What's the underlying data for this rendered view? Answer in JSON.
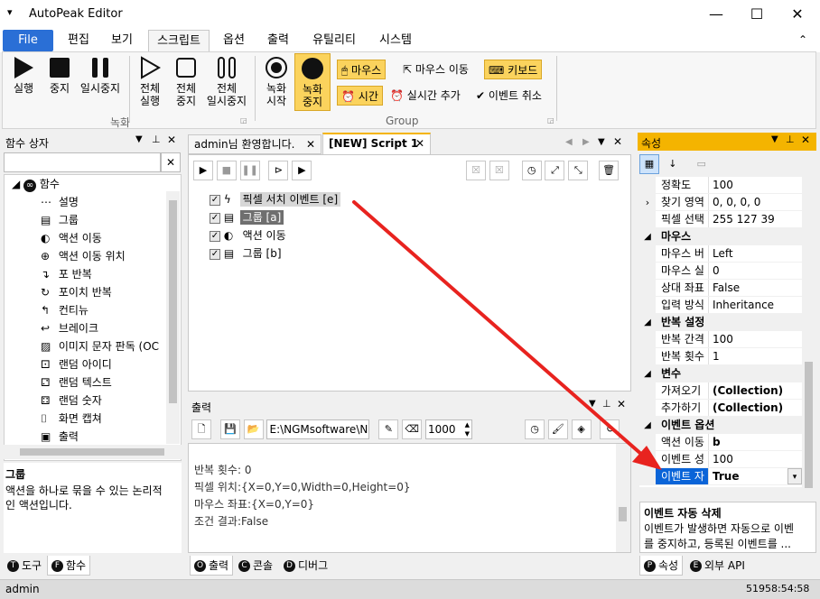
{
  "window": {
    "title": "AutoPeak Editor",
    "min": "—",
    "max": "☐",
    "close": "✕"
  },
  "menu": {
    "file": "File",
    "items": [
      "편집",
      "보기",
      "스크립트",
      "옵션",
      "출력",
      "유틸리티",
      "시스템"
    ]
  },
  "ribbon": {
    "run": "실행",
    "stop": "중지",
    "pause": "일시중지",
    "run_all": [
      "전체",
      "실행"
    ],
    "stop_all": [
      "전체",
      "중지"
    ],
    "pause_all": [
      "전체",
      "일시중지"
    ],
    "group_record": "녹화",
    "rec_start": [
      "녹화",
      "시작"
    ],
    "rec_stop": [
      "녹화",
      "중지"
    ],
    "mouse": "마우스",
    "mouse_move": "마우스 이동",
    "keyboard": "키보드",
    "time": "시간",
    "add_realtime": "실시간 추가",
    "cancel_event": "이벤트 취소",
    "group_label": "Group"
  },
  "left_panel": {
    "title": "함수 상자",
    "root": "함수",
    "items": [
      {
        "icon": "dots-circle-icon",
        "label": "설명"
      },
      {
        "icon": "group-icon",
        "label": "그룹"
      },
      {
        "icon": "action-move-icon",
        "label": "액션 이동"
      },
      {
        "icon": "action-move-position-icon",
        "label": "액션 이동 위치"
      },
      {
        "icon": "for-loop-icon",
        "label": "포 반복"
      },
      {
        "icon": "foreach-loop-icon",
        "label": "포이치 반복"
      },
      {
        "icon": "continue-icon",
        "label": "컨티뉴"
      },
      {
        "icon": "break-icon",
        "label": "브레이크"
      },
      {
        "icon": "image-text-icon",
        "label": "이미지 문자 판독 (OC"
      },
      {
        "icon": "random-id-icon",
        "label": "랜덤 아이디"
      },
      {
        "icon": "random-text-icon",
        "label": "랜덤 텍스트"
      },
      {
        "icon": "random-number-icon",
        "label": "랜덤 숫자"
      },
      {
        "icon": "screen-capture-icon",
        "label": "화면 캡쳐"
      },
      {
        "icon": "output-icon",
        "label": "출력"
      }
    ],
    "desc_title": "그룹",
    "desc_text": [
      "액션을 하나로 묶을 수 있는 논리적",
      "인 액션입니다."
    ],
    "tabs": [
      {
        "key": "T",
        "label": "도구"
      },
      {
        "key": "F",
        "label": "함수"
      }
    ]
  },
  "editor": {
    "tabs": [
      "admin님 환영합니다.",
      "[NEW] Script 1"
    ],
    "tree": [
      {
        "icon": "bolt-icon",
        "label": "픽셀 서치 이벤트 [e]",
        "hl": "light"
      },
      {
        "icon": "group-icon",
        "label": "그룹 [a]",
        "hl": "dark"
      },
      {
        "icon": "action-move-icon",
        "label": "액션 이동",
        "hl": "none"
      },
      {
        "icon": "group-icon",
        "label": "그룹 [b]",
        "hl": "none"
      }
    ]
  },
  "output": {
    "title": "출력",
    "path": "E:\\NGMsoftware\\NG",
    "count": "1000",
    "lines": [
      "반복 횟수: 0",
      "픽셀 위치:{X=0,Y=0,Width=0,Height=0}",
      "마우스 좌표:{X=0,Y=0}",
      "조건 결과:False"
    ],
    "tabs": [
      {
        "key": "O",
        "label": "출력"
      },
      {
        "key": "C",
        "label": "콘솔"
      },
      {
        "key": "D",
        "label": "디버그"
      }
    ]
  },
  "props": {
    "title": "속성",
    "rows": [
      {
        "type": "row",
        "name": "정확도",
        "value": "100"
      },
      {
        "type": "row",
        "name": "찾기 영역",
        "value": "0, 0, 0, 0",
        "expand": true
      },
      {
        "type": "row",
        "name": "픽셀 선택",
        "value": "255 127 39"
      },
      {
        "type": "cat",
        "name": "마우스"
      },
      {
        "type": "row",
        "name": "마우스 버",
        "value": "Left"
      },
      {
        "type": "row",
        "name": "마우스 실",
        "value": "0"
      },
      {
        "type": "row",
        "name": "상대 좌표",
        "value": "False"
      },
      {
        "type": "row",
        "name": "입력 방식",
        "value": "Inheritance"
      },
      {
        "type": "cat",
        "name": "반복 설정"
      },
      {
        "type": "row",
        "name": "반복 간격",
        "value": "100"
      },
      {
        "type": "row",
        "name": "반복 횟수",
        "value": "1"
      },
      {
        "type": "cat",
        "name": "변수"
      },
      {
        "type": "row",
        "name": "가져오기",
        "value": "(Collection)",
        "bold": true
      },
      {
        "type": "row",
        "name": "추가하기",
        "value": "(Collection)",
        "bold": true
      },
      {
        "type": "cat",
        "name": "이벤트 옵션"
      },
      {
        "type": "row",
        "name": "액션 이동",
        "value": "b",
        "bold": true
      },
      {
        "type": "row",
        "name": "이벤트 성",
        "value": "100"
      },
      {
        "type": "row",
        "name": "이벤트 자",
        "value": "True",
        "bold": true,
        "selected": true
      }
    ],
    "desc_title": "이벤트 자동 삭제",
    "desc_text": [
      "이벤트가 발생하면 자동으로 이벤",
      "를 중지하고, 등록된 이벤트를 ..."
    ],
    "tabs": [
      {
        "key": "P",
        "label": "속성"
      },
      {
        "key": "E",
        "label": "외부 API"
      }
    ]
  },
  "status": {
    "user": "admin",
    "time": "51958:54:58"
  },
  "colors": {
    "accent": "#2a6fd6",
    "highlight": "#fbd35d",
    "arrow": "#e8231f",
    "selected": "#0a64d8"
  }
}
